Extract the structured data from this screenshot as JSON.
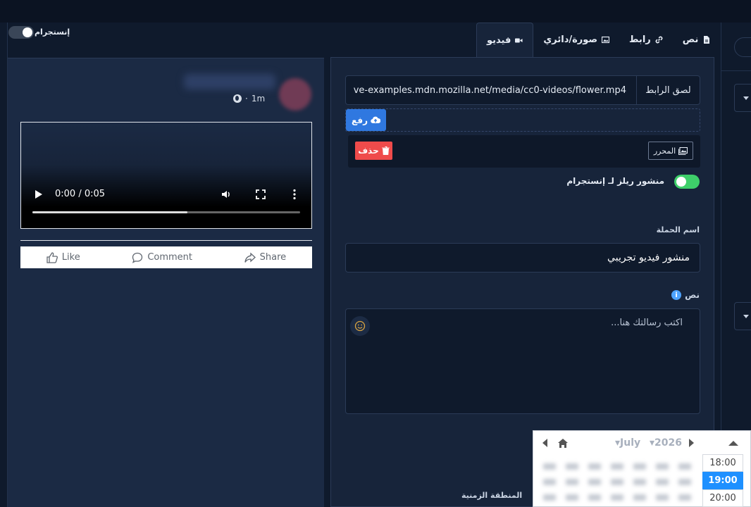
{
  "preview": {
    "instagram_toggle_label": "إنستجرام",
    "post_time": "1m",
    "post_time_sep": "·",
    "video_time": "0:00 / 0:05",
    "video_progress": 0.58,
    "actions": {
      "like": "Like",
      "comment": "Comment",
      "share": "Share"
    }
  },
  "tabs": [
    {
      "label": "نص",
      "icon": "file-icon"
    },
    {
      "label": "رابط",
      "icon": "link-icon"
    },
    {
      "label": "صورة/دائري",
      "icon": "image-icon"
    },
    {
      "label": "فيديو",
      "icon": "video-icon",
      "active": true
    }
  ],
  "form": {
    "url_label": "لصق الرابط",
    "url_value": "ve-examples.mdn.mozilla.net/media/cc0-videos/flower.mp4",
    "upload_label": "رفع",
    "delete_label": "حذف",
    "editor_label": "المحرر",
    "reels_label": "منشور ريلز لـ إنستجرام",
    "reels_enabled": true,
    "campaign_label": "اسم الحملة",
    "campaign_value": "منشور فيديو تجريبي",
    "text_label": "نص",
    "message_placeholder": "اكتب رسالتك هنا...",
    "timezone_label": "المنطقة الزمنية"
  },
  "picker": {
    "month": "July",
    "year": "2026",
    "times": [
      "18:00",
      "19:00",
      "20:00"
    ],
    "selected_time": "19:00"
  },
  "colors": {
    "accent": "#2f78e0",
    "danger": "#ef4b4b",
    "success": "#3ecf6a",
    "selected_time": "#1e90ff"
  }
}
